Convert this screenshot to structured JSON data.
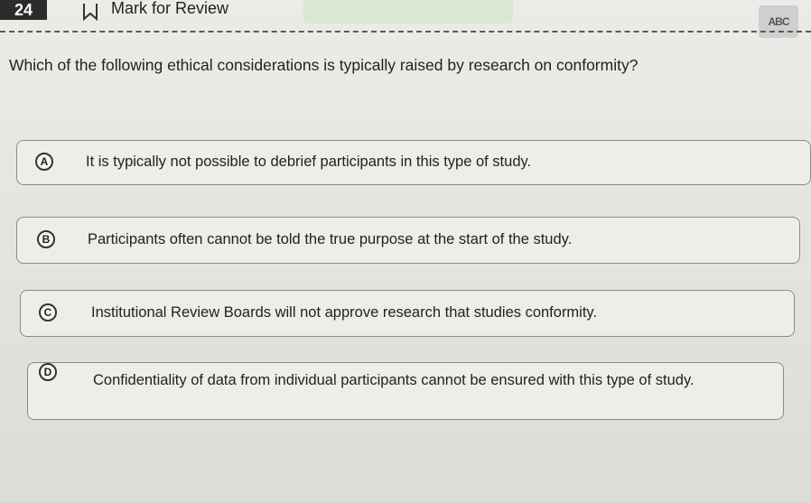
{
  "header": {
    "question_number": "24",
    "mark_label": "Mark for Review",
    "tool_label": "ABC"
  },
  "question": {
    "text": "Which of the following ethical considerations is typically raised by research on conformity?"
  },
  "options": [
    {
      "letter": "A",
      "text": "It is typically not possible to debrief participants in this type of study."
    },
    {
      "letter": "B",
      "text": "Participants often cannot be told the true purpose at the start of the study."
    },
    {
      "letter": "C",
      "text": "Institutional Review Boards will not approve research that studies conformity."
    },
    {
      "letter": "D",
      "text": "Confidentiality of data from individual participants cannot be ensured with this type of study."
    }
  ]
}
